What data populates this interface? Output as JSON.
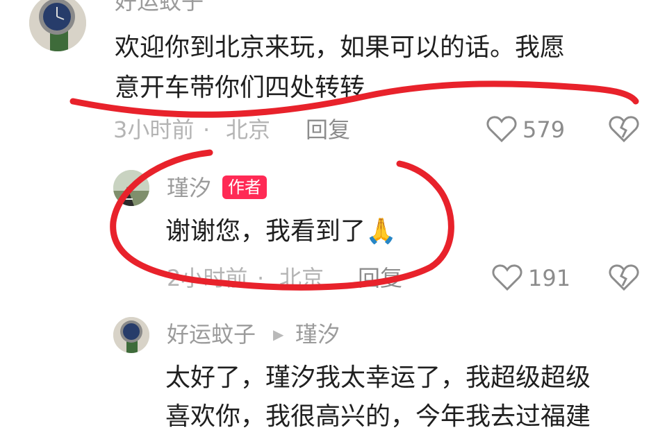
{
  "comments": [
    {
      "user": "好运蚊子",
      "text_lines": [
        "欢迎你到北京来玩，如果可以的话。我愿",
        "意开车带你们四处转转"
      ],
      "time": "3小时前",
      "location": "北京",
      "reply_label": "回复",
      "likes": "579"
    },
    {
      "user": "瑾汐",
      "badge": "作者",
      "text": "谢谢您，我看到了",
      "emoji": "🙏",
      "time": "2小时前",
      "location": "北京",
      "reply_label": "回复",
      "likes": "191"
    },
    {
      "user": "好运蚊子",
      "reply_to": "瑾汐",
      "text_lines": [
        "太好了，瑾汐我太幸运了，我超级超级",
        "喜欢你，我很高兴的，今年我去过福建"
      ]
    }
  ],
  "separator": "·",
  "icons": {
    "like": "heart-outline-icon",
    "dislike": "broken-heart-icon",
    "reply_arrow": "triangle-right-icon"
  },
  "colors": {
    "annotation": "#e8222b",
    "badge": "#ff2a55",
    "meta": "#b4b4b4"
  }
}
